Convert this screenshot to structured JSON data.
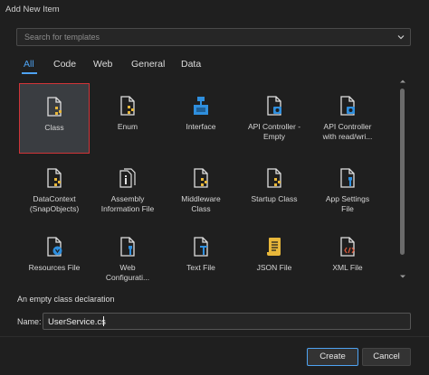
{
  "window": {
    "title": "Add New Item"
  },
  "search": {
    "placeholder": "Search for templates"
  },
  "tabs": [
    {
      "label": "All",
      "active": true
    },
    {
      "label": "Code",
      "active": false
    },
    {
      "label": "Web",
      "active": false
    },
    {
      "label": "General",
      "active": false
    },
    {
      "label": "Data",
      "active": false
    }
  ],
  "templates": [
    {
      "label": "Class",
      "icon": "class-file-icon",
      "selected": true
    },
    {
      "label": "Enum",
      "icon": "enum-file-icon"
    },
    {
      "label": "Interface",
      "icon": "interface-icon"
    },
    {
      "label": "API Controller -\nEmpty",
      "icon": "api-controller-icon"
    },
    {
      "label": "API Controller\nwith read/wri...",
      "icon": "api-controller-rw-icon"
    },
    {
      "label": "DataContext\n(SnapObjects)",
      "icon": "datacontext-file-icon"
    },
    {
      "label": "Assembly\nInformation File",
      "icon": "assembly-info-icon"
    },
    {
      "label": "Middleware\nClass",
      "icon": "middleware-class-icon"
    },
    {
      "label": "Startup Class",
      "icon": "startup-class-icon"
    },
    {
      "label": "App Settings\nFile",
      "icon": "app-settings-icon"
    },
    {
      "label": "Resources File",
      "icon": "resources-file-icon"
    },
    {
      "label": "Web\nConfigurati...",
      "icon": "web-config-icon"
    },
    {
      "label": "Text File",
      "icon": "text-file-icon"
    },
    {
      "label": "JSON File",
      "icon": "json-file-icon"
    },
    {
      "label": "XML File",
      "icon": "xml-file-icon"
    }
  ],
  "description": "An empty class declaration",
  "name_field": {
    "label": "Name:",
    "value": "UserService.cs"
  },
  "buttons": {
    "create": "Create",
    "cancel": "Cancel"
  },
  "colors": {
    "accent": "#4ea3f2",
    "selection_border": "#d13438",
    "background": "#1f1f1f",
    "icon_blue": "#2f8fde",
    "icon_yellow": "#e8b73a"
  }
}
